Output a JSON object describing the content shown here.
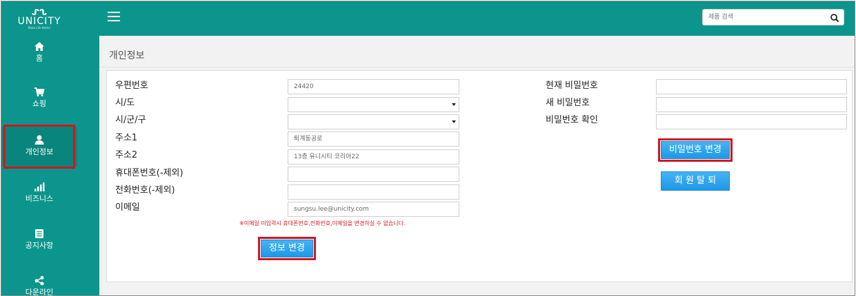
{
  "brand": {
    "name": "UNICITY",
    "tagline": "Make Life Better"
  },
  "sidebar": {
    "items": [
      {
        "label": "홈",
        "icon": "home-icon"
      },
      {
        "label": "쇼핑",
        "icon": "cart-icon"
      },
      {
        "label": "개인정보",
        "icon": "user-icon",
        "active": true
      },
      {
        "label": "비즈니스",
        "icon": "chart-icon"
      },
      {
        "label": "공지사항",
        "icon": "notice-icon"
      },
      {
        "label": "다운라인",
        "icon": "share-icon"
      }
    ]
  },
  "search": {
    "placeholder": "제품 검색",
    "icon": "search-icon"
  },
  "page": {
    "title": "개인정보"
  },
  "form": {
    "postal_label": "우편번호",
    "postal_value": "24420",
    "city_label": "시/도",
    "city_value": "",
    "district_label": "시/군/구",
    "district_value": "",
    "address1_label": "주소1",
    "address1_value": "퇴계동공로",
    "address2_label": "주소2",
    "address2_value": "13층 유니시티 코리아22",
    "mobile_label": "휴대폰번호(-제외)",
    "mobile_value": "",
    "phone_label": "전화번호(-제외)",
    "phone_value": "",
    "email_label": "이메일",
    "email_value": "sungsu.lee@unicity.com",
    "notice": "※이메일 미입력시 휴대폰번호,전화번호,이메일을 변경하실 수 없습니다.",
    "submit_label": "정보 변경"
  },
  "password": {
    "current_label": "현재 비밀번호",
    "new_label": "새 비밀번호",
    "confirm_label": "비밀번호 확인",
    "change_label": "비밀번호 변경",
    "withdraw_label": "회 원 탈 퇴"
  },
  "colors": {
    "sidebar": "#0c958c",
    "button": "#2ea3ec",
    "highlight": "#d2161e",
    "notice": "#d81b1b"
  }
}
